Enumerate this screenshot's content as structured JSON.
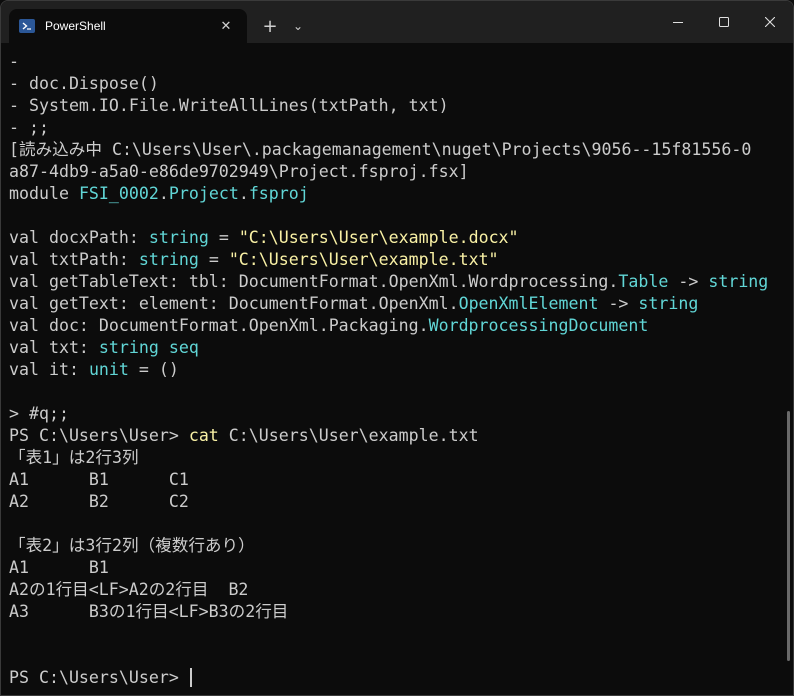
{
  "tab": {
    "title": "PowerShell",
    "close_glyph": "✕",
    "new_tab_glyph": "+",
    "dropdown_glyph": "⌄"
  },
  "icons": {
    "tab": "powershell-icon",
    "minimize": "minimize-icon",
    "maximize": "maximize-icon",
    "close": "close-icon"
  },
  "colors": {
    "background": "#0c0c0c",
    "text": "#cccccc",
    "type": "#61d6d6",
    "string": "#f9f1a5"
  },
  "terminal": {
    "l01": "-",
    "l02": "- doc.Dispose()",
    "l03": "- System.IO.File.WriteAllLines(txtPath, txt)",
    "l04": "- ;;",
    "l05": "[読み込み中 C:\\Users\\User\\.packagemanagement\\nuget\\Projects\\9056--15f81556-0",
    "l06": "a87-4db9-a5a0-e86de9702949\\Project.fsproj.fsx]",
    "l07": {
      "a": "module ",
      "b": "FSI_0002",
      "c": ".",
      "d": "Project",
      "e": ".",
      "f": "fsproj"
    },
    "l09": {
      "a": "val docxPath: ",
      "b": "string",
      "c": " = ",
      "d": "\"C:\\Users\\User\\example.docx\""
    },
    "l10": {
      "a": "val txtPath: ",
      "b": "string",
      "c": " = ",
      "d": "\"C:\\Users\\User\\example.txt\""
    },
    "l11": {
      "a": "val getTableText: tbl: DocumentFormat.OpenXml.Wordprocessing.",
      "b": "Table",
      "c": " -> ",
      "d": "string"
    },
    "l12": {
      "a": "val getText: element: DocumentFormat.OpenXml.",
      "b": "OpenXmlElement",
      "c": " -> ",
      "d": "string"
    },
    "l13": {
      "a": "val doc: DocumentFormat.OpenXml.Packaging.",
      "b": "WordprocessingDocument"
    },
    "l14": {
      "a": "val txt: ",
      "b": "string seq"
    },
    "l15": {
      "a": "val it: ",
      "b": "unit",
      "c": " = ()"
    },
    "l17": "> #q;;",
    "l18": {
      "a": "PS C:\\Users\\User> ",
      "b": "cat",
      "c": " C:\\Users\\User\\example.txt"
    },
    "l19": "「表1」は2行3列",
    "l20": "A1      B1      C1",
    "l21": "A2      B2      C2",
    "l23": "「表2」は3行2列（複数行あり）",
    "l24": "A1      B1",
    "l25": "A2の1行目<LF>A2の2行目  B2",
    "l26": "A3      B3の1行目<LF>B3の2行目",
    "l29": "PS C:\\Users\\User> "
  }
}
